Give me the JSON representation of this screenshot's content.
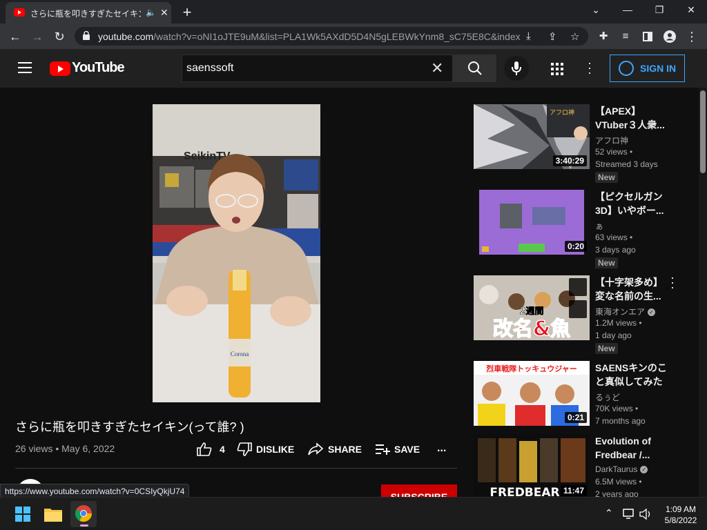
{
  "browser": {
    "tab_title": "さらに瓶を叩きすぎたセイキン(って",
    "url_host": "youtube.com",
    "url_path": "/watch?v=oNI1oJTE9uM&list=PLA1Wk5AXdD5D4N5gLEBWkYnm8_sC75E8C&index..."
  },
  "youtube": {
    "brand": "YouTube",
    "search_value": "saenssoft",
    "sign_in_label": "SIGN IN"
  },
  "video": {
    "title": "さらに瓶を叩きすぎたセイキン(って誰? )",
    "meta": "26 views • May 6, 2022",
    "like_count": "4",
    "dislike_label": "DISLIKE",
    "share_label": "SHARE",
    "save_label": "SAVE",
    "more_label": "...",
    "subscribe_label": "SUBSCRIBE",
    "overlay_text": "SeikinTV"
  },
  "status_url": "https://www.youtube.com/watch?v=0CSIyQkjU74",
  "related": [
    {
      "title": "【APEX】VTuber３人衆...",
      "channel": "アフロ神",
      "views": "52 views •",
      "age": "Streamed 3 days",
      "badge": "New",
      "duration": "3:40:29",
      "verified": false
    },
    {
      "title": "【ピクセルガン3D】いやボー...",
      "channel": "ぁ",
      "views": "63 views •",
      "age": "3 days ago",
      "badge": "New",
      "duration": "0:20",
      "verified": false
    },
    {
      "title": "【十字架多め】変な名前の生...",
      "channel": "東海オンエア",
      "views": "1.2M views •",
      "age": "1 day ago",
      "badge": "New",
      "duration": "",
      "verified": true,
      "thumb_text_top": "2週間",
      "thumb_text_main": "改名&魚"
    },
    {
      "title": "SAENSキンのこと真似してみた",
      "channel": "るぅど",
      "views": "70K views •",
      "age": "7 months ago",
      "badge": "",
      "duration": "0:21",
      "verified": false,
      "thumb_text_top": "烈車戦隊トッキュウジャー"
    },
    {
      "title": "Evolution of Fredbear /...",
      "channel": "DarkTaurus",
      "views": "6.5M views •",
      "age": "2 years ago",
      "badge": "",
      "duration": "11:47",
      "verified": true,
      "thumb_text_main": "FREDBEAR"
    }
  ],
  "taskbar": {
    "time": "1:09 AM",
    "date": "5/8/2022"
  },
  "colors": {
    "yt_red": "#ff0000",
    "link_blue": "#3ea6ff",
    "subscribe_red": "#cc0000"
  }
}
